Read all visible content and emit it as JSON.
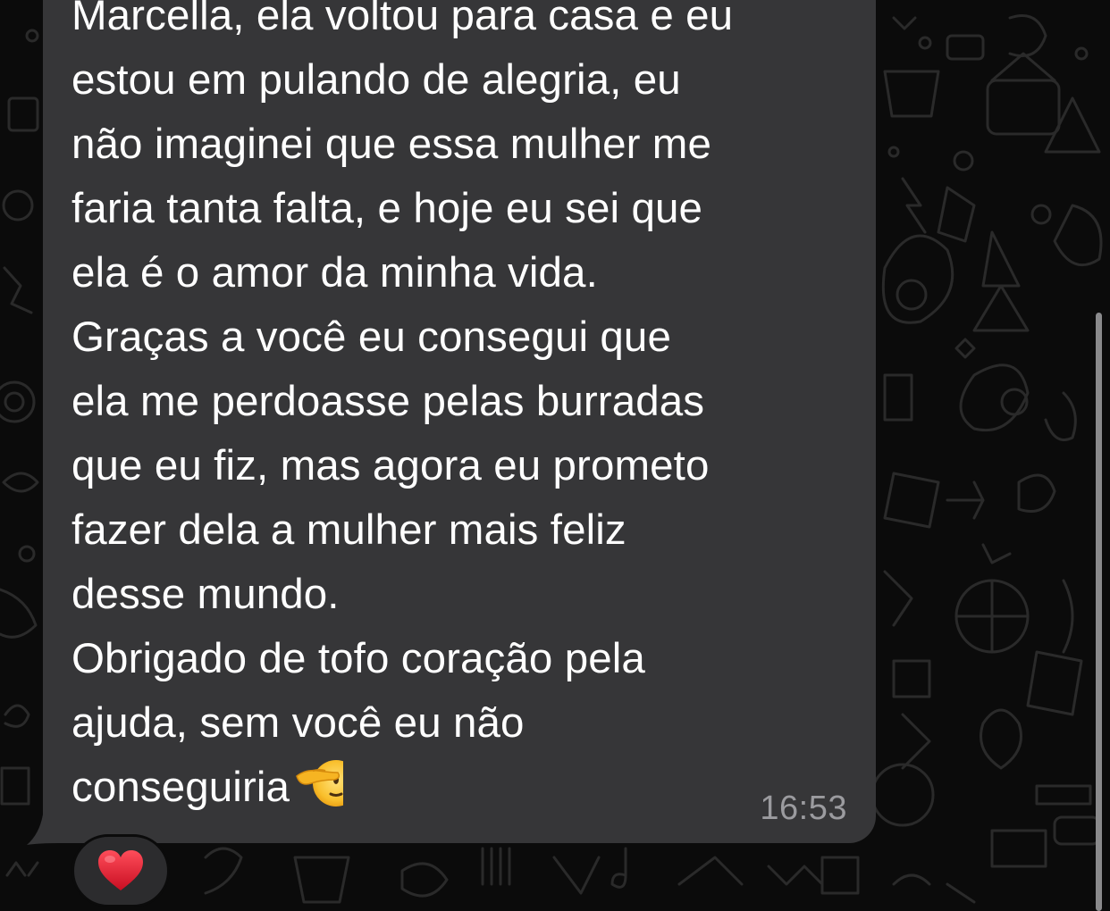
{
  "message": {
    "text": "Marcella, ela voltou para casa e eu\nestou em pulando de alegria, eu\nnão imaginei que essa mulher me\nfaria tanta falta, e hoje eu sei que\nela é o amor da minha vida.\nGraças a você eu consegui que\nela me perdoasse pelas burradas\nque eu fiz, mas agora eu prometo\nfazer dela a mulher mais feliz\ndesse mundo.\nObrigado de tofo coração pela\najuda, sem você eu não\nconseguiria",
    "emoji": "saluting-face-icon",
    "time": "16:53"
  },
  "reaction": {
    "emoji": "heart-icon",
    "color": "#e3132c"
  },
  "theme": {
    "bubble_color": "#363638",
    "background_color": "#0b0b0b",
    "text_color": "#ffffff",
    "timestamp_color": "#9b9b9f"
  }
}
